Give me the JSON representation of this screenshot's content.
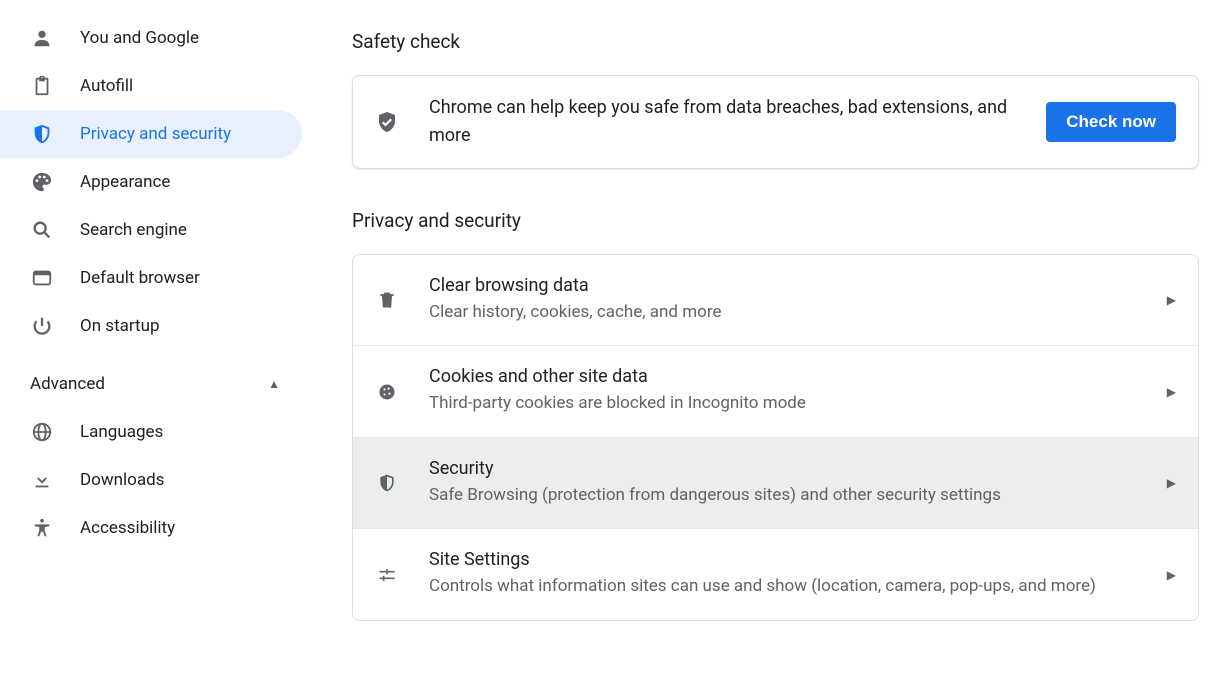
{
  "sidebar": {
    "items": [
      {
        "id": "you-google",
        "label": "You and Google",
        "icon": "person"
      },
      {
        "id": "autofill",
        "label": "Autofill",
        "icon": "clipboard"
      },
      {
        "id": "privacy-security",
        "label": "Privacy and security",
        "icon": "shield",
        "active": true
      },
      {
        "id": "appearance",
        "label": "Appearance",
        "icon": "palette"
      },
      {
        "id": "search-engine",
        "label": "Search engine",
        "icon": "search"
      },
      {
        "id": "default-browser",
        "label": "Default browser",
        "icon": "browser"
      },
      {
        "id": "on-startup",
        "label": "On startup",
        "icon": "power"
      }
    ],
    "advanced_label": "Advanced",
    "advanced_items": [
      {
        "id": "languages",
        "label": "Languages",
        "icon": "globe"
      },
      {
        "id": "downloads",
        "label": "Downloads",
        "icon": "download"
      },
      {
        "id": "accessibility",
        "label": "Accessibility",
        "icon": "accessibility"
      }
    ]
  },
  "main": {
    "safety_check": {
      "title": "Safety check",
      "description": "Chrome can help keep you safe from data breaches, bad extensions, and more",
      "button_label": "Check now"
    },
    "privacy_security": {
      "title": "Privacy and security",
      "rows": [
        {
          "id": "clear-browsing-data",
          "icon": "trash",
          "title": "Clear browsing data",
          "subtitle": "Clear history, cookies, cache, and more"
        },
        {
          "id": "cookies",
          "icon": "cookie",
          "title": "Cookies and other site data",
          "subtitle": "Third-party cookies are blocked in Incognito mode"
        },
        {
          "id": "security",
          "icon": "shield",
          "title": "Security",
          "subtitle": "Safe Browsing (protection from dangerous sites) and other security settings",
          "hover": true
        },
        {
          "id": "site-settings",
          "icon": "tune",
          "title": "Site Settings",
          "subtitle": "Controls what information sites can use and show (location, camera, pop-ups, and more)"
        }
      ]
    }
  }
}
